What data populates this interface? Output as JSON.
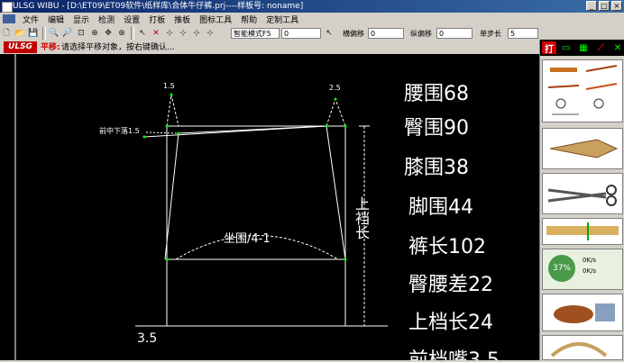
{
  "window": {
    "title": "ULSG WIBU - [D:\\ET09\\ET09软件\\纸样库\\合体牛仔裤.prj----样板号: noname]"
  },
  "menu": [
    "文件",
    "编辑",
    "显示",
    "检测",
    "设置",
    "打板",
    "推板",
    "图标工具",
    "帮助",
    "定制工具"
  ],
  "toolbar": {
    "mode_select": "智能模式F5",
    "mode_value": "0",
    "h_offset_label": "横偏移",
    "h_offset_value": "0",
    "v_offset_label": "纵偏移",
    "v_offset_value": "0",
    "step_label": "单步长",
    "step_value": "5"
  },
  "status": {
    "logo": "ULSG",
    "mode": "平移:",
    "prompt": "请选择平移对象，按右键确认..."
  },
  "drawing": {
    "dim_left": "1.5",
    "dim_right": "2.5",
    "front_drop_label": "前中下落1.5",
    "hip_label": "坐围/4-1",
    "rise_label": "上裆长",
    "bottom_dim": "3.5"
  },
  "measurements": [
    {
      "name": "腰围",
      "value": "68"
    },
    {
      "name": "臀围",
      "value": "90"
    },
    {
      "name": "膝围",
      "value": "38"
    },
    {
      "name": "脚围",
      "value": "44"
    },
    {
      "name": "裤长",
      "value": "102"
    },
    {
      "name": "臀腰差",
      "value": "22"
    },
    {
      "name": "上档长",
      "value": "24"
    },
    {
      "name": "前档嘴",
      "value": "3.5"
    }
  ],
  "sidebar": {
    "top_button": "打",
    "progress_percent": "37%",
    "speed_up": "0K/s",
    "speed_down": "0K/s"
  },
  "colors": {
    "canvas": "#000000",
    "line": "#ffffff",
    "guide": "#00ff00",
    "title_bar": "#0a246a"
  }
}
